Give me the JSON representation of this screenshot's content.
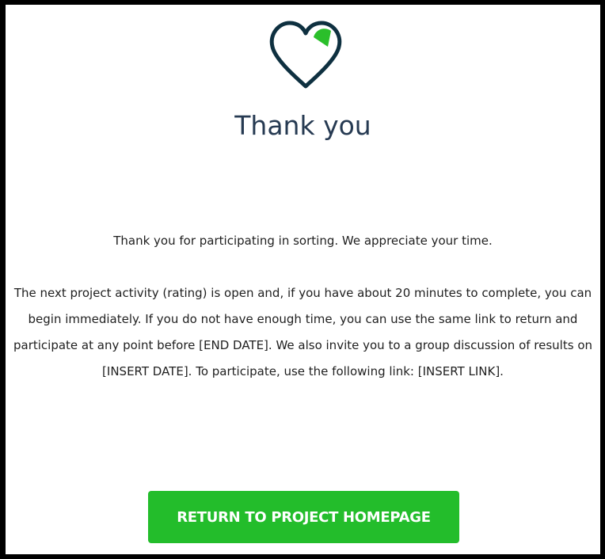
{
  "logo": {
    "icon": "heart-icon",
    "colors": {
      "outline": "#0e3040",
      "accent": "#2bbf2b"
    }
  },
  "page": {
    "title": "Thank you",
    "message_line1": "Thank you for participating in sorting. We appreciate your time.",
    "message_line2": "The next project activity (rating) is open and, if you have about 20 minutes to complete, you can begin immediately. If you do not have enough time, you can use the same link to return and participate at any point before [END DATE]. We also invite you to a group discussion of results on [INSERT DATE]. To participate, use the following link: [INSERT LINK]."
  },
  "actions": {
    "return_label": "RETURN TO PROJECT HOMEPAGE"
  },
  "theme": {
    "button_color": "#23bd2b",
    "title_color": "#263a52",
    "frame_color": "#000000"
  }
}
